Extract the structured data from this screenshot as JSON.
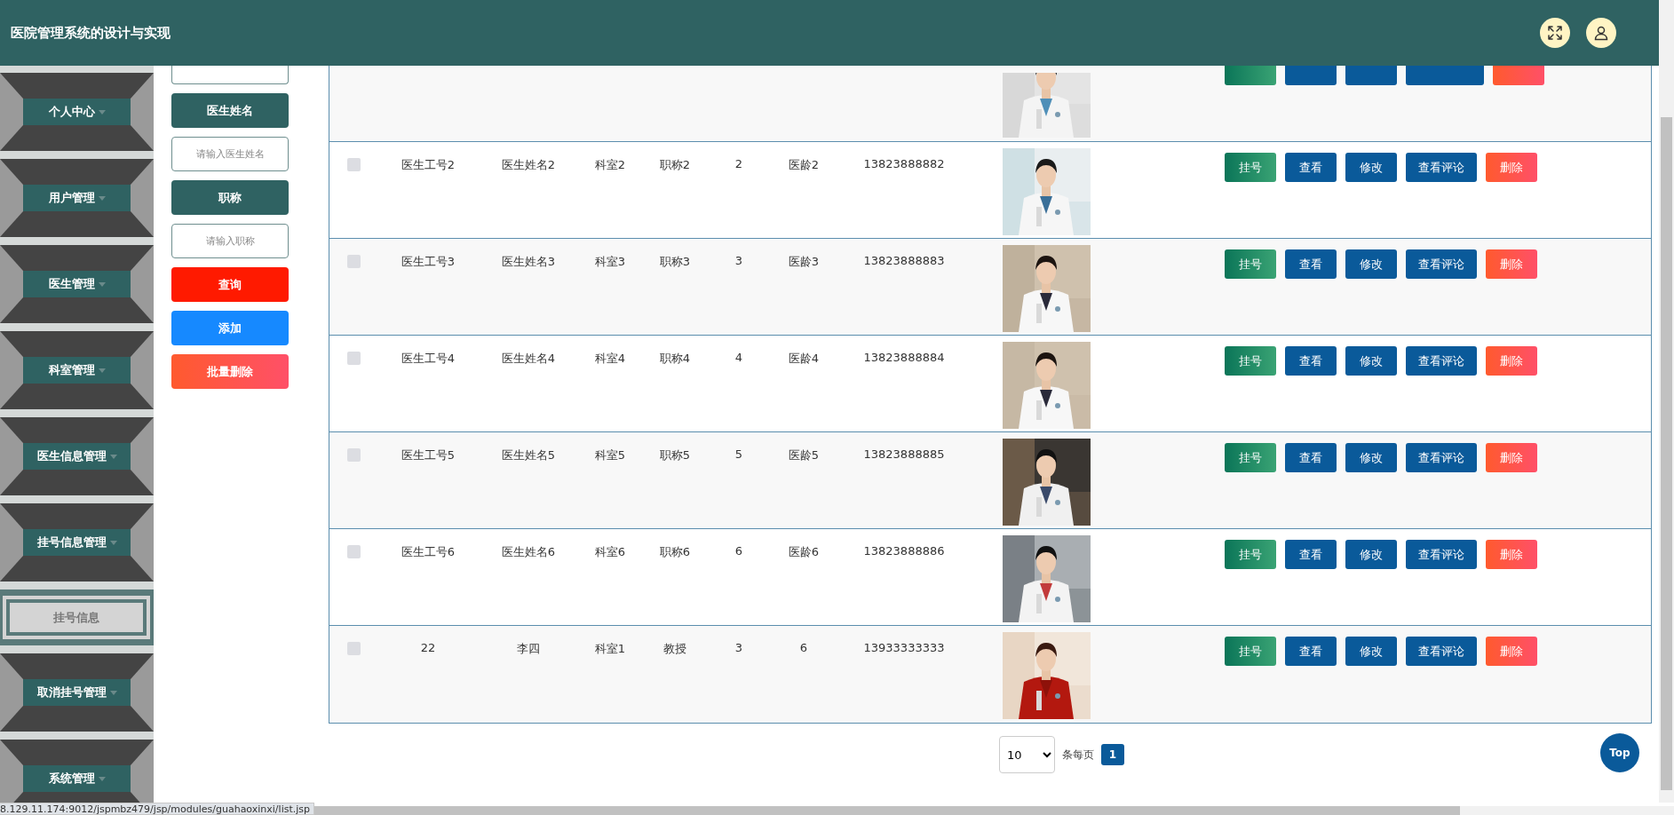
{
  "header": {
    "title": "医院管理系统的设计与实现"
  },
  "sidebar": {
    "items": [
      {
        "label": "个人中心",
        "kind": "group",
        "selected": false
      },
      {
        "label": "用户管理",
        "kind": "group",
        "selected": false
      },
      {
        "label": "医生管理",
        "kind": "group",
        "selected": false
      },
      {
        "label": "科室管理",
        "kind": "group",
        "selected": false
      },
      {
        "label": "医生信息管理",
        "kind": "group",
        "selected": false
      },
      {
        "label": "挂号信息管理",
        "kind": "group",
        "selected": false
      },
      {
        "label": "挂号信息",
        "kind": "subitem",
        "selected": true
      },
      {
        "label": "取消挂号管理",
        "kind": "group",
        "selected": false
      },
      {
        "label": "系统管理",
        "kind": "group",
        "selected": false
      }
    ]
  },
  "search": {
    "items": [
      {
        "kind": "label",
        "text": "医生姓名"
      },
      {
        "kind": "field",
        "placeholder": "请输入医生姓名"
      },
      {
        "kind": "label",
        "text": "职称"
      },
      {
        "kind": "field",
        "placeholder": "请输入职称"
      },
      {
        "kind": "query",
        "text": "查询"
      },
      {
        "kind": "add",
        "text": "添加"
      },
      {
        "kind": "batch-delete",
        "text": "批量删除"
      }
    ]
  },
  "table": {
    "cut_row": {
      "actions": [
        {
          "kind": "register"
        },
        {
          "kind": "view"
        },
        {
          "kind": "edit"
        },
        {
          "kind": "comments"
        },
        {
          "kind": "delete"
        }
      ]
    },
    "rows": [
      {
        "checked": false,
        "cells": [
          "医生工号2",
          "医生姓名2",
          "科室2",
          "职称2",
          "2",
          "医龄2",
          "13823888882"
        ],
        "actions": [
          {
            "label": "挂号",
            "kind": "register"
          },
          {
            "label": "查看",
            "kind": "view"
          },
          {
            "label": "修改",
            "kind": "edit"
          },
          {
            "label": "查看评论",
            "kind": "comments"
          },
          {
            "label": "删除",
            "kind": "delete"
          }
        ]
      },
      {
        "checked": false,
        "cells": [
          "医生工号3",
          "医生姓名3",
          "科室3",
          "职称3",
          "3",
          "医龄3",
          "13823888883"
        ],
        "actions": [
          {
            "label": "挂号",
            "kind": "register"
          },
          {
            "label": "查看",
            "kind": "view"
          },
          {
            "label": "修改",
            "kind": "edit"
          },
          {
            "label": "查看评论",
            "kind": "comments"
          },
          {
            "label": "删除",
            "kind": "delete"
          }
        ]
      },
      {
        "checked": false,
        "cells": [
          "医生工号4",
          "医生姓名4",
          "科室4",
          "职称4",
          "4",
          "医龄4",
          "13823888884"
        ],
        "actions": [
          {
            "label": "挂号",
            "kind": "register"
          },
          {
            "label": "查看",
            "kind": "view"
          },
          {
            "label": "修改",
            "kind": "edit"
          },
          {
            "label": "查看评论",
            "kind": "comments"
          },
          {
            "label": "删除",
            "kind": "delete"
          }
        ]
      },
      {
        "checked": false,
        "cells": [
          "医生工号5",
          "医生姓名5",
          "科室5",
          "职称5",
          "5",
          "医龄5",
          "13823888885"
        ],
        "actions": [
          {
            "label": "挂号",
            "kind": "register"
          },
          {
            "label": "查看",
            "kind": "view"
          },
          {
            "label": "修改",
            "kind": "edit"
          },
          {
            "label": "查看评论",
            "kind": "comments"
          },
          {
            "label": "删除",
            "kind": "delete"
          }
        ]
      },
      {
        "checked": false,
        "cells": [
          "医生工号6",
          "医生姓名6",
          "科室6",
          "职称6",
          "6",
          "医龄6",
          "13823888886"
        ],
        "actions": [
          {
            "label": "挂号",
            "kind": "register"
          },
          {
            "label": "查看",
            "kind": "view"
          },
          {
            "label": "修改",
            "kind": "edit"
          },
          {
            "label": "查看评论",
            "kind": "comments"
          },
          {
            "label": "删除",
            "kind": "delete"
          }
        ]
      },
      {
        "checked": false,
        "cells": [
          "22",
          "李四",
          "科室1",
          "教授",
          "3",
          "6",
          "13933333333"
        ],
        "actions": [
          {
            "label": "挂号",
            "kind": "register"
          },
          {
            "label": "查看",
            "kind": "view"
          },
          {
            "label": "修改",
            "kind": "edit"
          },
          {
            "label": "查看评论",
            "kind": "comments"
          },
          {
            "label": "删除",
            "kind": "delete"
          }
        ]
      }
    ]
  },
  "pagination": {
    "page_size": "10",
    "page_size_label": "条每页",
    "pages": [
      {
        "label": "1",
        "selected": true
      }
    ]
  },
  "top_button": "Top",
  "status_url": "8.129.11.174:9012/jspmbz479/jsp/modules/guahaoxinxi/list.jsp"
}
